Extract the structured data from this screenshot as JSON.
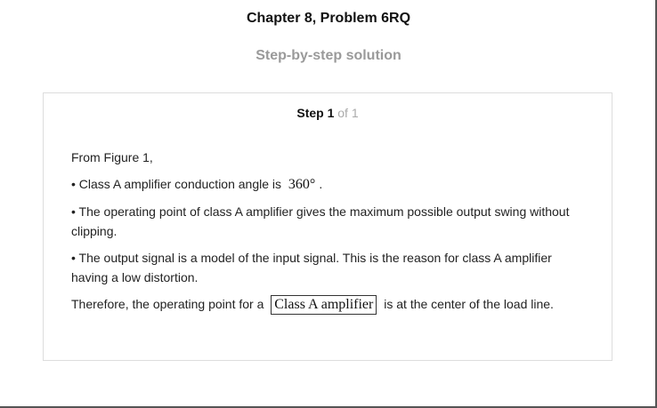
{
  "header": {
    "title": "Chapter 8, Problem 6RQ",
    "subtitle": "Step-by-step solution"
  },
  "step": {
    "label": "Step 1",
    "of": "of 1"
  },
  "content": {
    "intro": "From Figure 1,",
    "bullet1_text": "• Class A amplifier conduction angle is",
    "bullet1_math": "360°",
    "bullet1_end": ".",
    "bullet2": "• The operating point of class A amplifier gives the maximum possible output swing without clipping.",
    "bullet3": "• The output signal is a model of the input signal. This is the reason for class A amplifier having a low distortion.",
    "conclusion_pre": "Therefore, the operating point for a",
    "conclusion_box": "Class A amplifier",
    "conclusion_post": "is at the center of the load line."
  }
}
